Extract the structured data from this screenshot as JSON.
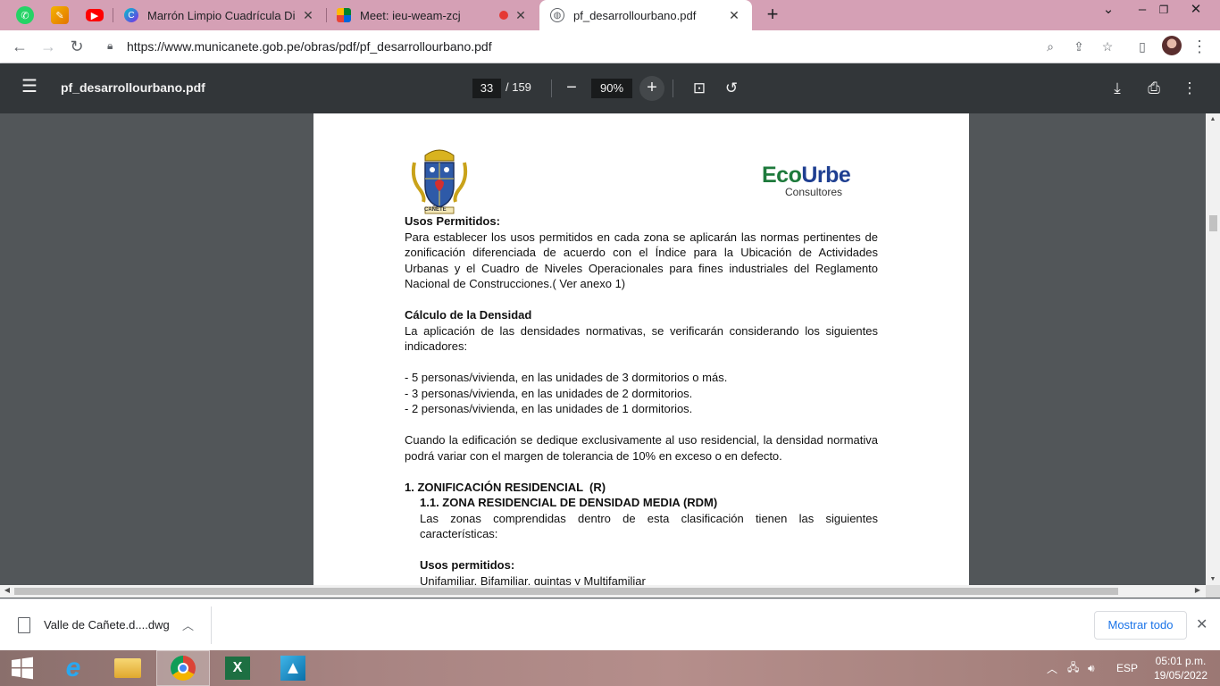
{
  "browser": {
    "tabs": [
      {
        "title": "Marrón Limpio Cuadrícula Diseño",
        "icon": "canva-icon"
      },
      {
        "title": "Meet: ieu-weam-zcj",
        "icon": "meet-icon"
      },
      {
        "title": "pf_desarrollourbano.pdf",
        "icon": "globe-icon"
      }
    ],
    "url": "https://www.municanete.gob.pe/obras/pdf/pf_desarrollourbano.pdf"
  },
  "pdf_toolbar": {
    "filename": "pf_desarrollourbano.pdf",
    "page_current": "33",
    "page_total": "/ 159",
    "zoom": "90%"
  },
  "document": {
    "brand": {
      "eco": "Eco",
      "urbe": "Urbe",
      "sub": "Consultores",
      "crest_label": "CAÑETE"
    },
    "usos_title": "Usos Permitidos:",
    "usos_text": "Para establecer los usos permitidos en cada zona se aplicarán las normas pertinentes de zonificación diferenciada de acuerdo con el Índice para la Ubicación de Actividades Urbanas y el Cuadro de Niveles Operacionales para fines industriales del Reglamento Nacional de Construcciones.( Ver anexo 1)",
    "densidad_title": "Cálculo de la Densidad",
    "densidad_text": "La aplicación de las densidades normativas, se verificarán considerando los siguientes indicadores:",
    "bullets": [
      "- 5 personas/vivienda, en las unidades de 3 dormitorios o más.",
      "- 3 personas/vivienda, en las unidades de 2 dormitorios.",
      "- 2 personas/vivienda, en las unidades de 1 dormitorios."
    ],
    "tolerancia_text": "Cuando la edificación se dedique exclusivamente al uso residencial, la densidad normativa podrá variar con el margen de tolerancia de 10% en exceso o en defecto.",
    "sec1_title": "1. ZONIFICACIÓN RESIDENCIAL  (R)",
    "sec11_title": "1.1. ZONA RESIDENCIAL DE DENSIDAD MEDIA (RDM)",
    "sec11_text": "Las zonas comprendidas dentro de esta clasificación tienen las siguientes características:",
    "usos2_title": "Usos permitidos:",
    "usos2_text": "Unifamiliar, Bifamiliar, quintas y Multifamiliar"
  },
  "downloads": {
    "file": "Valle de Cañete.d....dwg",
    "show_all": "Mostrar todo"
  },
  "taskbar": {
    "lang": "ESP",
    "time": "05:01 p.m.",
    "date": "19/05/2022"
  }
}
